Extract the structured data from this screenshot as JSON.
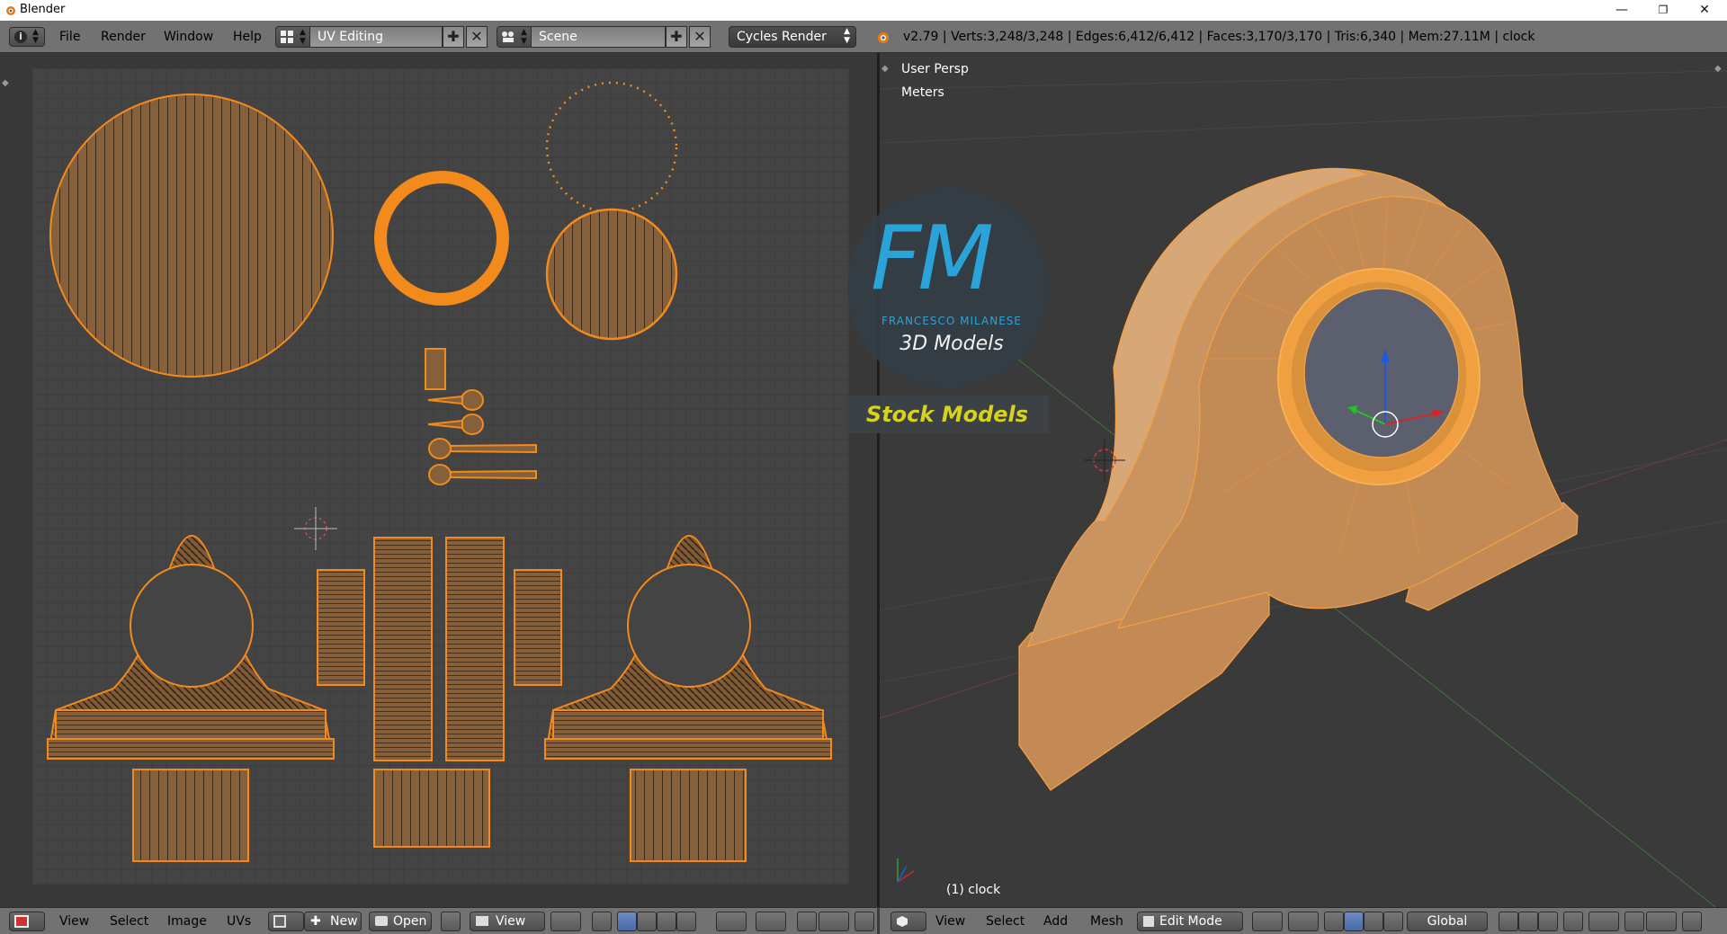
{
  "window": {
    "title": "Blender",
    "controls": [
      "—",
      "❐",
      "✕"
    ]
  },
  "info_header": {
    "menus": [
      "File",
      "Render",
      "Window",
      "Help"
    ],
    "screen_layout": "UV Editing",
    "scene": "Scene",
    "render_engine": "Cycles Render",
    "stats": "v2.79 | Verts:3,248/3,248 | Edges:6,412/6,412 | Faces:3,170/3,170 | Tris:6,340 | Mem:27.11M | clock"
  },
  "viewport": {
    "view_name": "User Persp",
    "units": "Meters",
    "object_label": "(1) clock"
  },
  "watermark": {
    "logo_letters": "FM",
    "author": "FRANCESCO MILANESE",
    "tagline": "3D Models",
    "banner": "Stock Models"
  },
  "uv_header": {
    "menus": [
      "View",
      "Select",
      "Image",
      "UVs"
    ],
    "new_label": "New",
    "open_label": "Open",
    "view_label": "View"
  },
  "view3d_header": {
    "menus": [
      "View",
      "Select",
      "Add",
      "Mesh"
    ],
    "mode": "Edit Mode",
    "orientation": "Global"
  },
  "colors": {
    "uv_orange": "#f28a1c",
    "mesh_orange": "#c8925a",
    "header_gray": "#727272",
    "watermark_blue": "#29a3d8",
    "watermark_yellow": "#d7d21e"
  }
}
